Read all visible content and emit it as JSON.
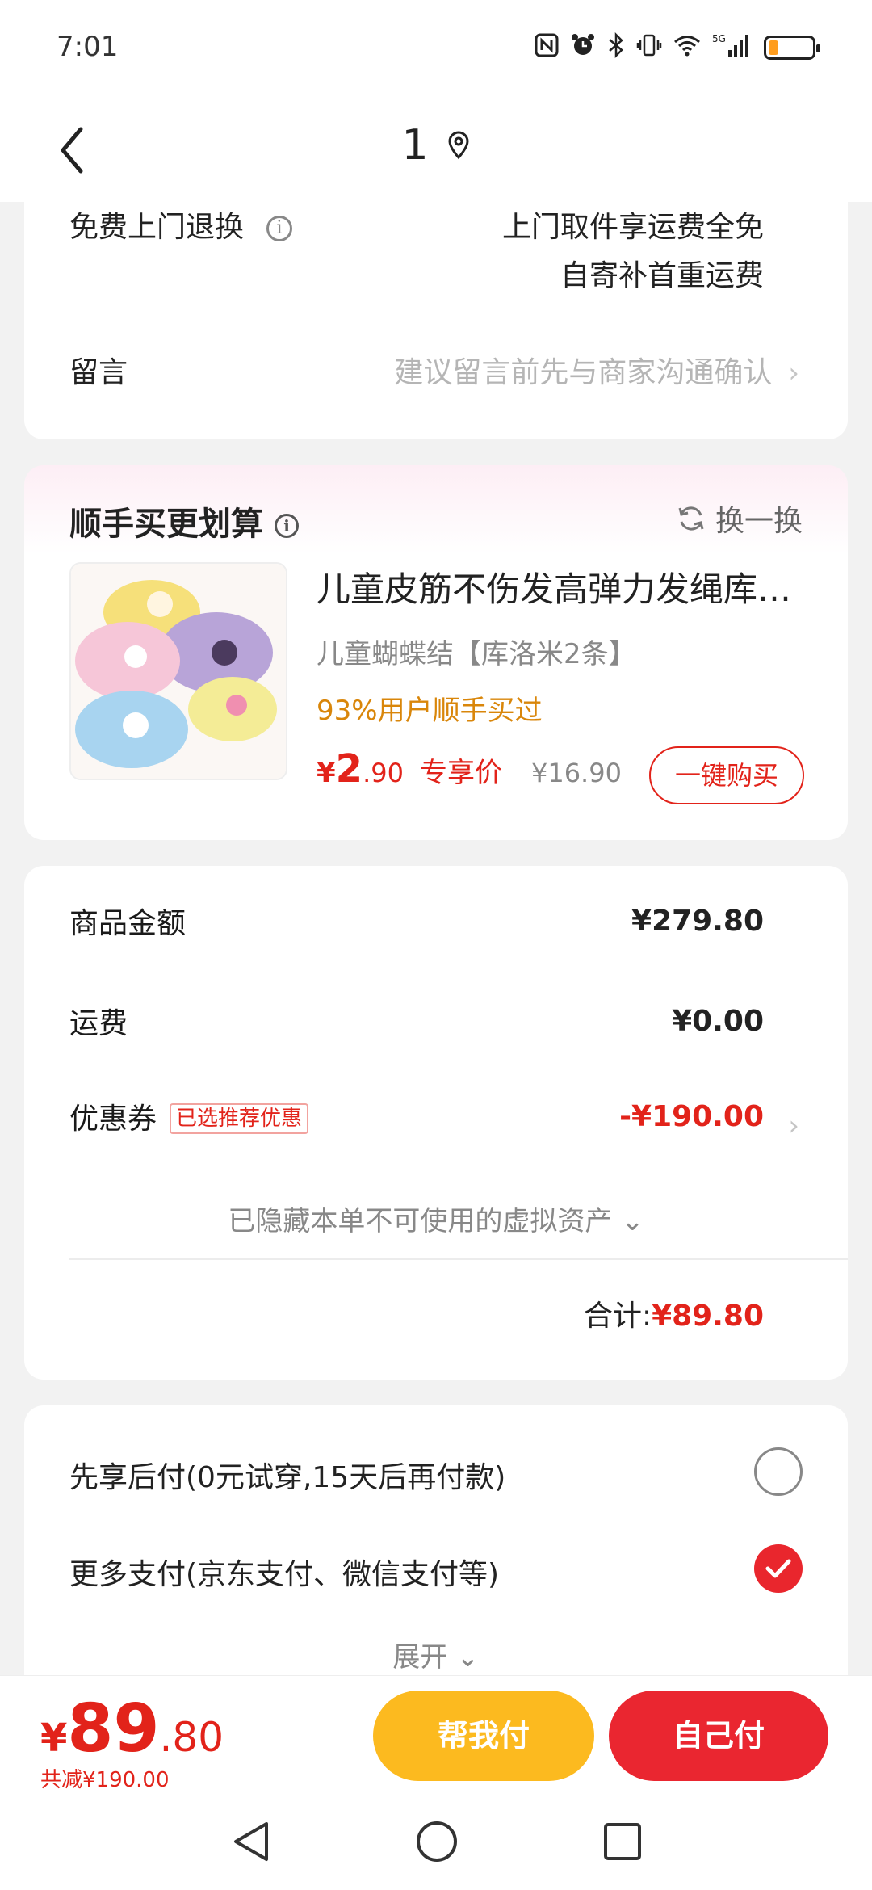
{
  "status_bar": {
    "time": "7:01",
    "icons": [
      "nfc-icon",
      "alarm-icon",
      "bluetooth-icon",
      "vibrate-icon",
      "wifi-icon",
      "signal-5g-icon",
      "battery-icon"
    ],
    "network": "5G",
    "battery_color": "#ff9d1e"
  },
  "nav": {
    "title": "1",
    "back_icon": "back-chevron-icon",
    "location_icon": "location-pin-icon"
  },
  "service": {
    "return_label": "免费上门退换",
    "return_line1": "上门取件享运费全免",
    "return_line2": "自寄补首重运费",
    "message_label": "留言",
    "message_placeholder": "建议留言前先与商家沟通确认"
  },
  "addon": {
    "title": "顺手买更划算",
    "swap_label": "换一换",
    "product": {
      "title": "儿童皮筋不伤发高弹力发绳库…",
      "variant": "儿童蝴蝶结【库洛米2条】",
      "social_proof": "93%用户顺手买过",
      "price_currency": "¥",
      "price_int": "2",
      "price_dec": ".90",
      "price_tag": "专享价",
      "original_price": "¥16.90",
      "buy_label": "一键购买"
    }
  },
  "summary": {
    "goods_label": "商品金额",
    "goods_value": "¥279.80",
    "shipping_label": "运费",
    "shipping_value": "¥0.00",
    "coupon_label": "优惠券",
    "coupon_badge": "已选推荐优惠",
    "coupon_value": "-¥190.00",
    "hidden_assets": "已隐藏本单不可使用的虚拟资产",
    "total_label": "合计:",
    "total_value": "¥89.80"
  },
  "payment": {
    "option1": "先享后付(0元试穿,15天后再付款)",
    "option2": "更多支付(京东支付、微信支付等)",
    "option1_selected": false,
    "option2_selected": true,
    "expand_label": "展开"
  },
  "bottom": {
    "currency": "¥",
    "price_int": "89",
    "price_dec": ".80",
    "saved": "共减¥190.00",
    "help_pay": "帮我付",
    "self_pay": "自己付"
  },
  "colors": {
    "accent_red": "#e2231a",
    "button_yellow": "#fcba1f",
    "button_red": "#ea2630",
    "social_orange": "#d9860a"
  }
}
